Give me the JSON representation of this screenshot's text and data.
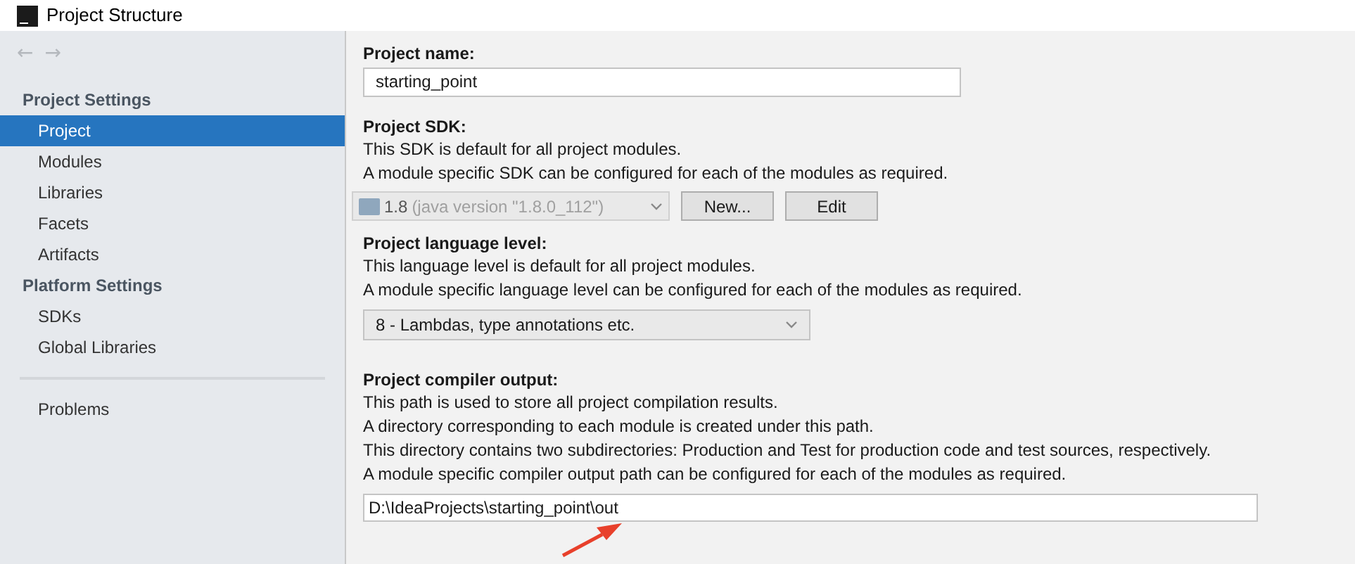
{
  "window": {
    "title": "Project Structure"
  },
  "nav": [
    {
      "glyph": "←",
      "disabled": true
    },
    {
      "glyph": "→",
      "disabled": true
    }
  ],
  "sidebar": {
    "groups": [
      {
        "heading": "Project Settings",
        "items": [
          {
            "label": "Project",
            "selected": true
          },
          {
            "label": "Modules",
            "selected": false
          },
          {
            "label": "Libraries",
            "selected": false
          },
          {
            "label": "Facets",
            "selected": false
          },
          {
            "label": "Artifacts",
            "selected": false
          }
        ]
      },
      {
        "heading": "Platform Settings",
        "items": [
          {
            "label": "SDKs",
            "selected": false
          },
          {
            "label": "Global Libraries",
            "selected": false
          }
        ]
      }
    ],
    "bottom_items": [
      {
        "label": "Problems",
        "selected": false
      }
    ]
  },
  "project_name": {
    "label": "Project name:",
    "value": "starting_point"
  },
  "project_sdk": {
    "label": "Project SDK:",
    "description": [
      "This SDK is default for all project modules.",
      "A module specific SDK can be configured for each of the modules as required."
    ],
    "combo": {
      "version": "1.8",
      "detail": "(java version \"1.8.0_112\")",
      "disabled": true
    },
    "buttons": [
      "New...",
      "Edit"
    ]
  },
  "language_level": {
    "label": "Project language level:",
    "description": [
      "This language level is default for all project modules.",
      "A module specific language level can be configured for each of the modules as required."
    ],
    "combo": {
      "value": "8 - Lambdas, type annotations etc."
    }
  },
  "compiler_output": {
    "label": "Project compiler output:",
    "description": [
      "This path is used to store all project compilation results.",
      "A directory corresponding to each module is created under this path.",
      "This directory contains two subdirectories: Production and Test for production code and test sources, respectively.",
      "A module specific compiler output path can be configured for each of the modules as required."
    ],
    "value": "D:\\IdeaProjects\\starting_point\\out"
  }
}
